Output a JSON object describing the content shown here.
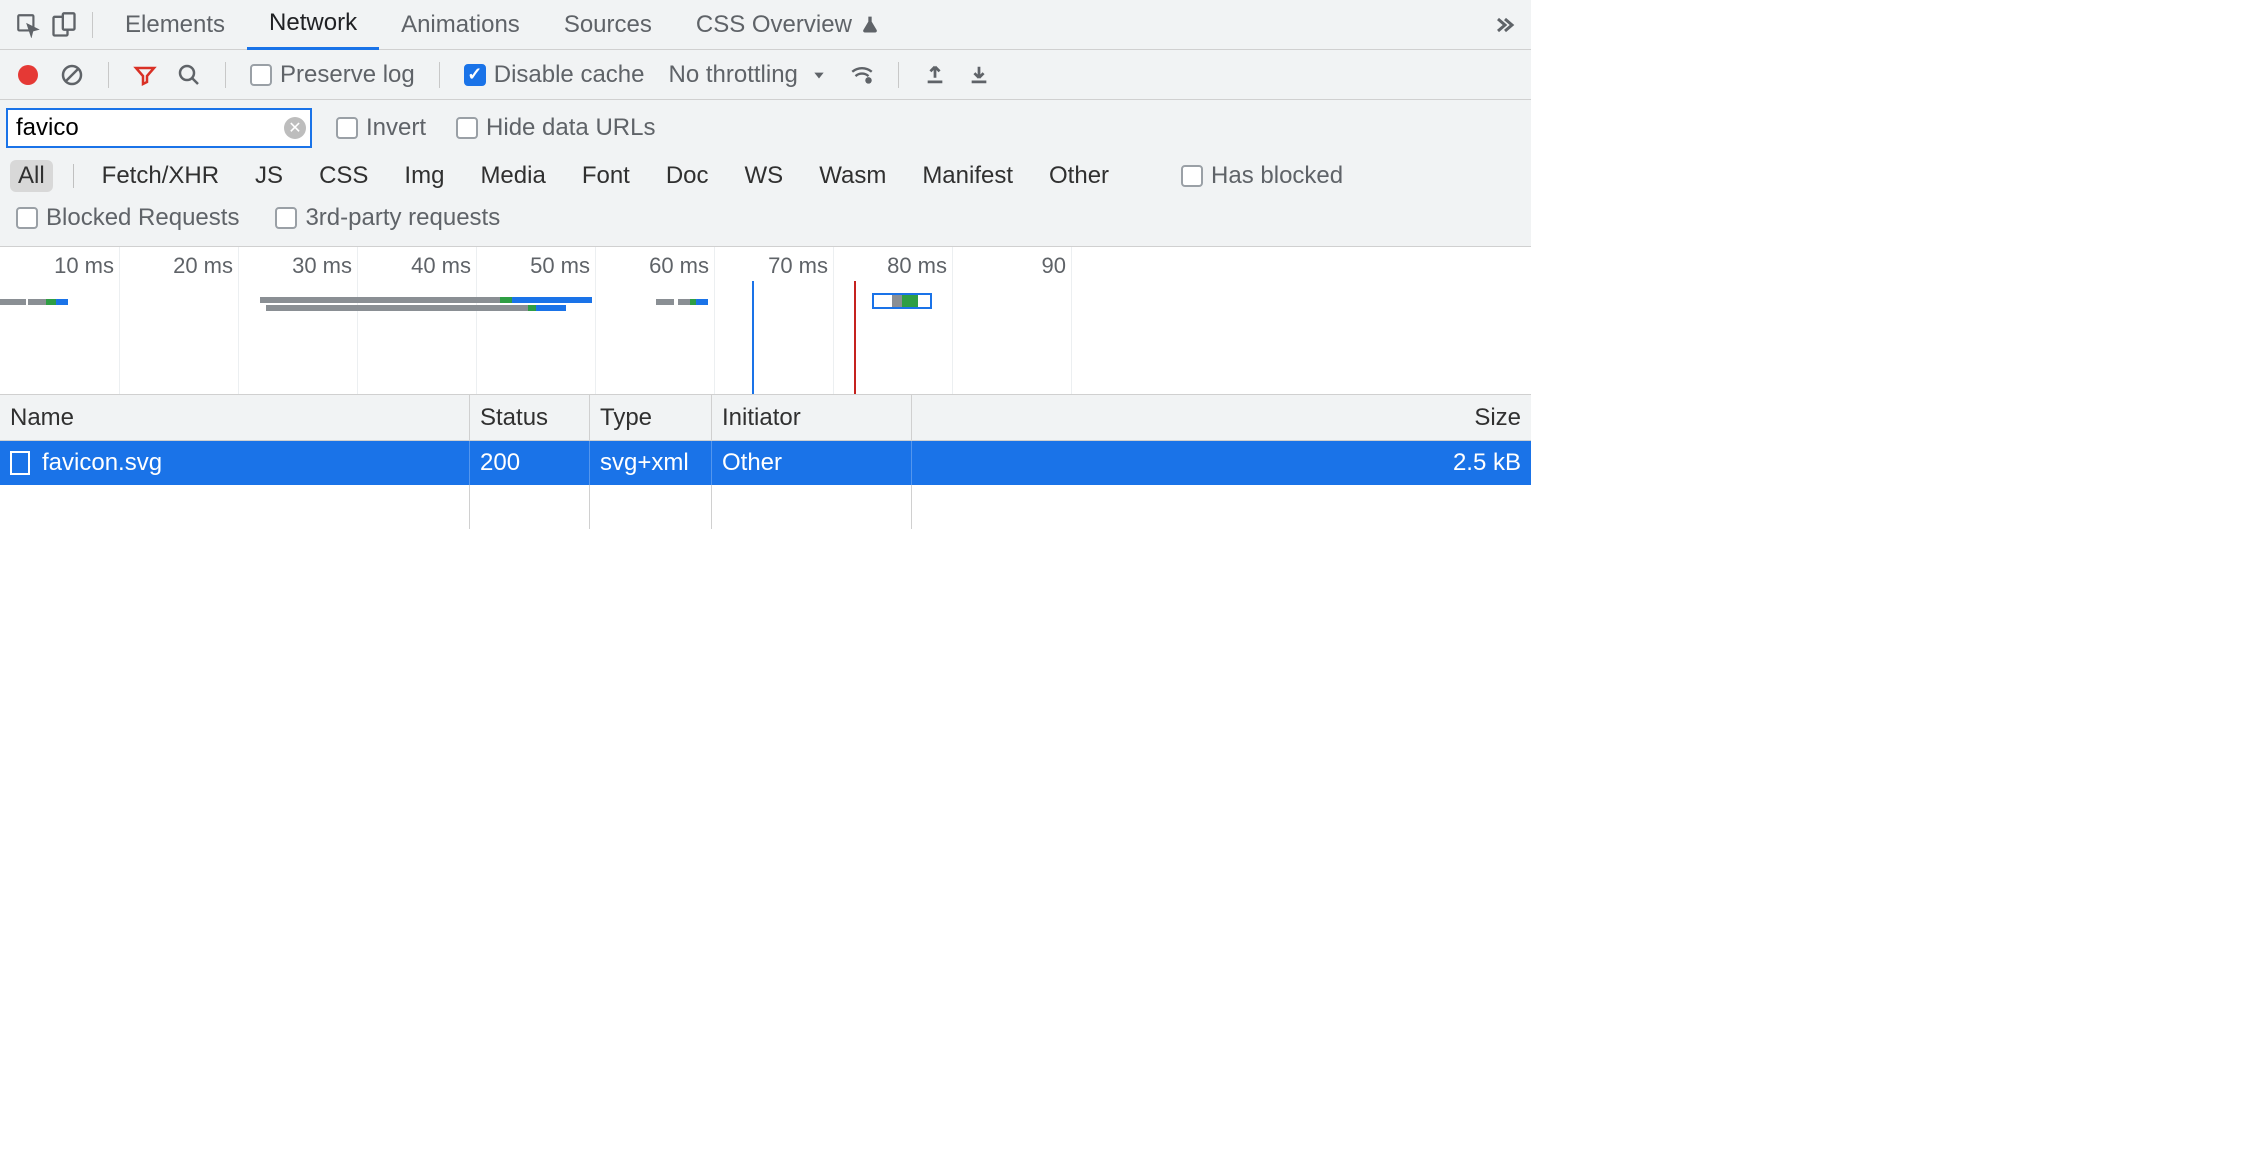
{
  "tabs": {
    "elements": "Elements",
    "network": "Network",
    "animations": "Animations",
    "sources": "Sources",
    "css_overview": "CSS Overview"
  },
  "toolbar": {
    "preserve_log": "Preserve log",
    "disable_cache": "Disable cache",
    "throttling": "No throttling"
  },
  "filter": {
    "value": "favico",
    "invert": "Invert",
    "hide_data_urls": "Hide data URLs",
    "has_blocked": "Has blocked",
    "blocked_requests": "Blocked Requests",
    "third_party": "3rd-party requests"
  },
  "types": {
    "all": "All",
    "fetch": "Fetch/XHR",
    "js": "JS",
    "css": "CSS",
    "img": "Img",
    "media": "Media",
    "font": "Font",
    "doc": "Doc",
    "ws": "WS",
    "wasm": "Wasm",
    "manifest": "Manifest",
    "other": "Other"
  },
  "timeline_ticks": [
    "10 ms",
    "20 ms",
    "30 ms",
    "40 ms",
    "50 ms",
    "60 ms",
    "70 ms",
    "80 ms",
    "90 "
  ],
  "table": {
    "headers": {
      "name": "Name",
      "status": "Status",
      "type": "Type",
      "initiator": "Initiator",
      "size": "Size"
    },
    "rows": [
      {
        "name": "favicon.svg",
        "status": "200",
        "type": "svg+xml",
        "initiator": "Other",
        "size": "2.5 kB"
      }
    ]
  }
}
